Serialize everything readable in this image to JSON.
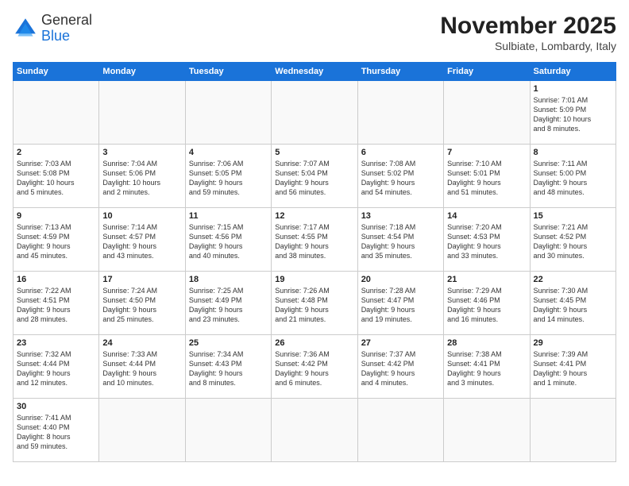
{
  "header": {
    "logo_general": "General",
    "logo_blue": "Blue",
    "month_title": "November 2025",
    "subtitle": "Sulbiate, Lombardy, Italy"
  },
  "weekdays": [
    "Sunday",
    "Monday",
    "Tuesday",
    "Wednesday",
    "Thursday",
    "Friday",
    "Saturday"
  ],
  "weeks": [
    [
      {
        "day": "",
        "info": ""
      },
      {
        "day": "",
        "info": ""
      },
      {
        "day": "",
        "info": ""
      },
      {
        "day": "",
        "info": ""
      },
      {
        "day": "",
        "info": ""
      },
      {
        "day": "",
        "info": ""
      },
      {
        "day": "1",
        "info": "Sunrise: 7:01 AM\nSunset: 5:09 PM\nDaylight: 10 hours\nand 8 minutes."
      }
    ],
    [
      {
        "day": "2",
        "info": "Sunrise: 7:03 AM\nSunset: 5:08 PM\nDaylight: 10 hours\nand 5 minutes."
      },
      {
        "day": "3",
        "info": "Sunrise: 7:04 AM\nSunset: 5:06 PM\nDaylight: 10 hours\nand 2 minutes."
      },
      {
        "day": "4",
        "info": "Sunrise: 7:06 AM\nSunset: 5:05 PM\nDaylight: 9 hours\nand 59 minutes."
      },
      {
        "day": "5",
        "info": "Sunrise: 7:07 AM\nSunset: 5:04 PM\nDaylight: 9 hours\nand 56 minutes."
      },
      {
        "day": "6",
        "info": "Sunrise: 7:08 AM\nSunset: 5:02 PM\nDaylight: 9 hours\nand 54 minutes."
      },
      {
        "day": "7",
        "info": "Sunrise: 7:10 AM\nSunset: 5:01 PM\nDaylight: 9 hours\nand 51 minutes."
      },
      {
        "day": "8",
        "info": "Sunrise: 7:11 AM\nSunset: 5:00 PM\nDaylight: 9 hours\nand 48 minutes."
      }
    ],
    [
      {
        "day": "9",
        "info": "Sunrise: 7:13 AM\nSunset: 4:59 PM\nDaylight: 9 hours\nand 45 minutes."
      },
      {
        "day": "10",
        "info": "Sunrise: 7:14 AM\nSunset: 4:57 PM\nDaylight: 9 hours\nand 43 minutes."
      },
      {
        "day": "11",
        "info": "Sunrise: 7:15 AM\nSunset: 4:56 PM\nDaylight: 9 hours\nand 40 minutes."
      },
      {
        "day": "12",
        "info": "Sunrise: 7:17 AM\nSunset: 4:55 PM\nDaylight: 9 hours\nand 38 minutes."
      },
      {
        "day": "13",
        "info": "Sunrise: 7:18 AM\nSunset: 4:54 PM\nDaylight: 9 hours\nand 35 minutes."
      },
      {
        "day": "14",
        "info": "Sunrise: 7:20 AM\nSunset: 4:53 PM\nDaylight: 9 hours\nand 33 minutes."
      },
      {
        "day": "15",
        "info": "Sunrise: 7:21 AM\nSunset: 4:52 PM\nDaylight: 9 hours\nand 30 minutes."
      }
    ],
    [
      {
        "day": "16",
        "info": "Sunrise: 7:22 AM\nSunset: 4:51 PM\nDaylight: 9 hours\nand 28 minutes."
      },
      {
        "day": "17",
        "info": "Sunrise: 7:24 AM\nSunset: 4:50 PM\nDaylight: 9 hours\nand 25 minutes."
      },
      {
        "day": "18",
        "info": "Sunrise: 7:25 AM\nSunset: 4:49 PM\nDaylight: 9 hours\nand 23 minutes."
      },
      {
        "day": "19",
        "info": "Sunrise: 7:26 AM\nSunset: 4:48 PM\nDaylight: 9 hours\nand 21 minutes."
      },
      {
        "day": "20",
        "info": "Sunrise: 7:28 AM\nSunset: 4:47 PM\nDaylight: 9 hours\nand 19 minutes."
      },
      {
        "day": "21",
        "info": "Sunrise: 7:29 AM\nSunset: 4:46 PM\nDaylight: 9 hours\nand 16 minutes."
      },
      {
        "day": "22",
        "info": "Sunrise: 7:30 AM\nSunset: 4:45 PM\nDaylight: 9 hours\nand 14 minutes."
      }
    ],
    [
      {
        "day": "23",
        "info": "Sunrise: 7:32 AM\nSunset: 4:44 PM\nDaylight: 9 hours\nand 12 minutes."
      },
      {
        "day": "24",
        "info": "Sunrise: 7:33 AM\nSunset: 4:44 PM\nDaylight: 9 hours\nand 10 minutes."
      },
      {
        "day": "25",
        "info": "Sunrise: 7:34 AM\nSunset: 4:43 PM\nDaylight: 9 hours\nand 8 minutes."
      },
      {
        "day": "26",
        "info": "Sunrise: 7:36 AM\nSunset: 4:42 PM\nDaylight: 9 hours\nand 6 minutes."
      },
      {
        "day": "27",
        "info": "Sunrise: 7:37 AM\nSunset: 4:42 PM\nDaylight: 9 hours\nand 4 minutes."
      },
      {
        "day": "28",
        "info": "Sunrise: 7:38 AM\nSunset: 4:41 PM\nDaylight: 9 hours\nand 3 minutes."
      },
      {
        "day": "29",
        "info": "Sunrise: 7:39 AM\nSunset: 4:41 PM\nDaylight: 9 hours\nand 1 minute."
      }
    ],
    [
      {
        "day": "30",
        "info": "Sunrise: 7:41 AM\nSunset: 4:40 PM\nDaylight: 8 hours\nand 59 minutes."
      },
      {
        "day": "",
        "info": ""
      },
      {
        "day": "",
        "info": ""
      },
      {
        "day": "",
        "info": ""
      },
      {
        "day": "",
        "info": ""
      },
      {
        "day": "",
        "info": ""
      },
      {
        "day": "",
        "info": ""
      }
    ]
  ]
}
